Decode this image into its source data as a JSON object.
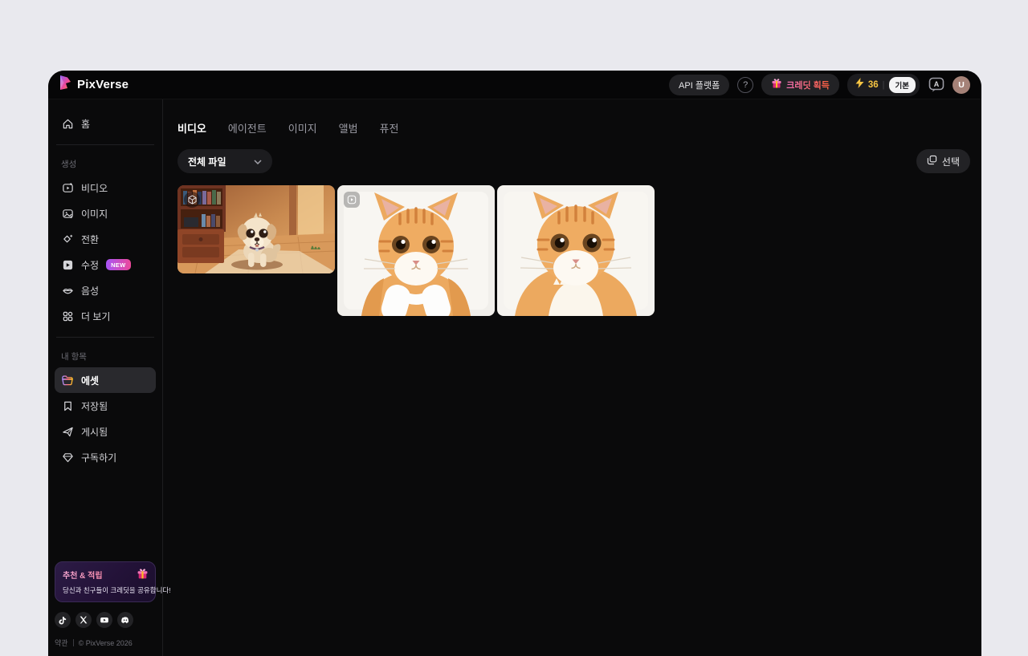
{
  "header": {
    "logo_text": "PixVerse",
    "api_platform": "API 플랫폼",
    "help": "?",
    "earn_credits": "크레딧 획득",
    "credits": "36",
    "credits_separator": "|",
    "plan_badge": "기본",
    "avatar_initial": "U"
  },
  "sidebar": {
    "home": "홈",
    "section_create": {
      "title": "생성",
      "items": [
        {
          "label": "비디오"
        },
        {
          "label": "이미지"
        },
        {
          "label": "전환"
        },
        {
          "label": "수정",
          "badge": "NEW"
        },
        {
          "label": "음성"
        },
        {
          "label": "더 보기"
        }
      ]
    },
    "section_my": {
      "title": "내 항목",
      "items": [
        {
          "label": "에셋",
          "active": true
        },
        {
          "label": "저장됨"
        },
        {
          "label": "게시됨"
        },
        {
          "label": "구독하기"
        }
      ]
    },
    "promo": {
      "title": "추천 & 적립",
      "subtitle": "당신과 친구들이 크레딧을 공유합니다!"
    },
    "footer": {
      "terms": "약관",
      "copyright": "© PixVerse 2026"
    }
  },
  "main": {
    "tabs": [
      {
        "label": "비디오",
        "active": true
      },
      {
        "label": "에이전트",
        "active": false
      },
      {
        "label": "이미지",
        "active": false
      },
      {
        "label": "앨범",
        "active": false
      },
      {
        "label": "퓨전",
        "active": false
      }
    ],
    "filter_dropdown": "전체 파일",
    "select_button": "선택",
    "assets": [
      {
        "kind": "video",
        "badge_icon": "cube-3d-badge-icon",
        "subject": "puppy-room-scene"
      },
      {
        "kind": "video",
        "badge_icon": "video-play-badge-icon",
        "subject": "orange-cat-portrait-paws"
      },
      {
        "kind": "image",
        "badge_icon": "",
        "subject": "orange-cat-portrait"
      }
    ]
  },
  "colors": {
    "page_background": "#e9e9ee",
    "window_background": "#0a0a0b",
    "accent_purple": "#a855f7",
    "accent_pink": "#ec4899",
    "accent_orange": "#fb923c",
    "credits_yellow": "#f5c443"
  }
}
